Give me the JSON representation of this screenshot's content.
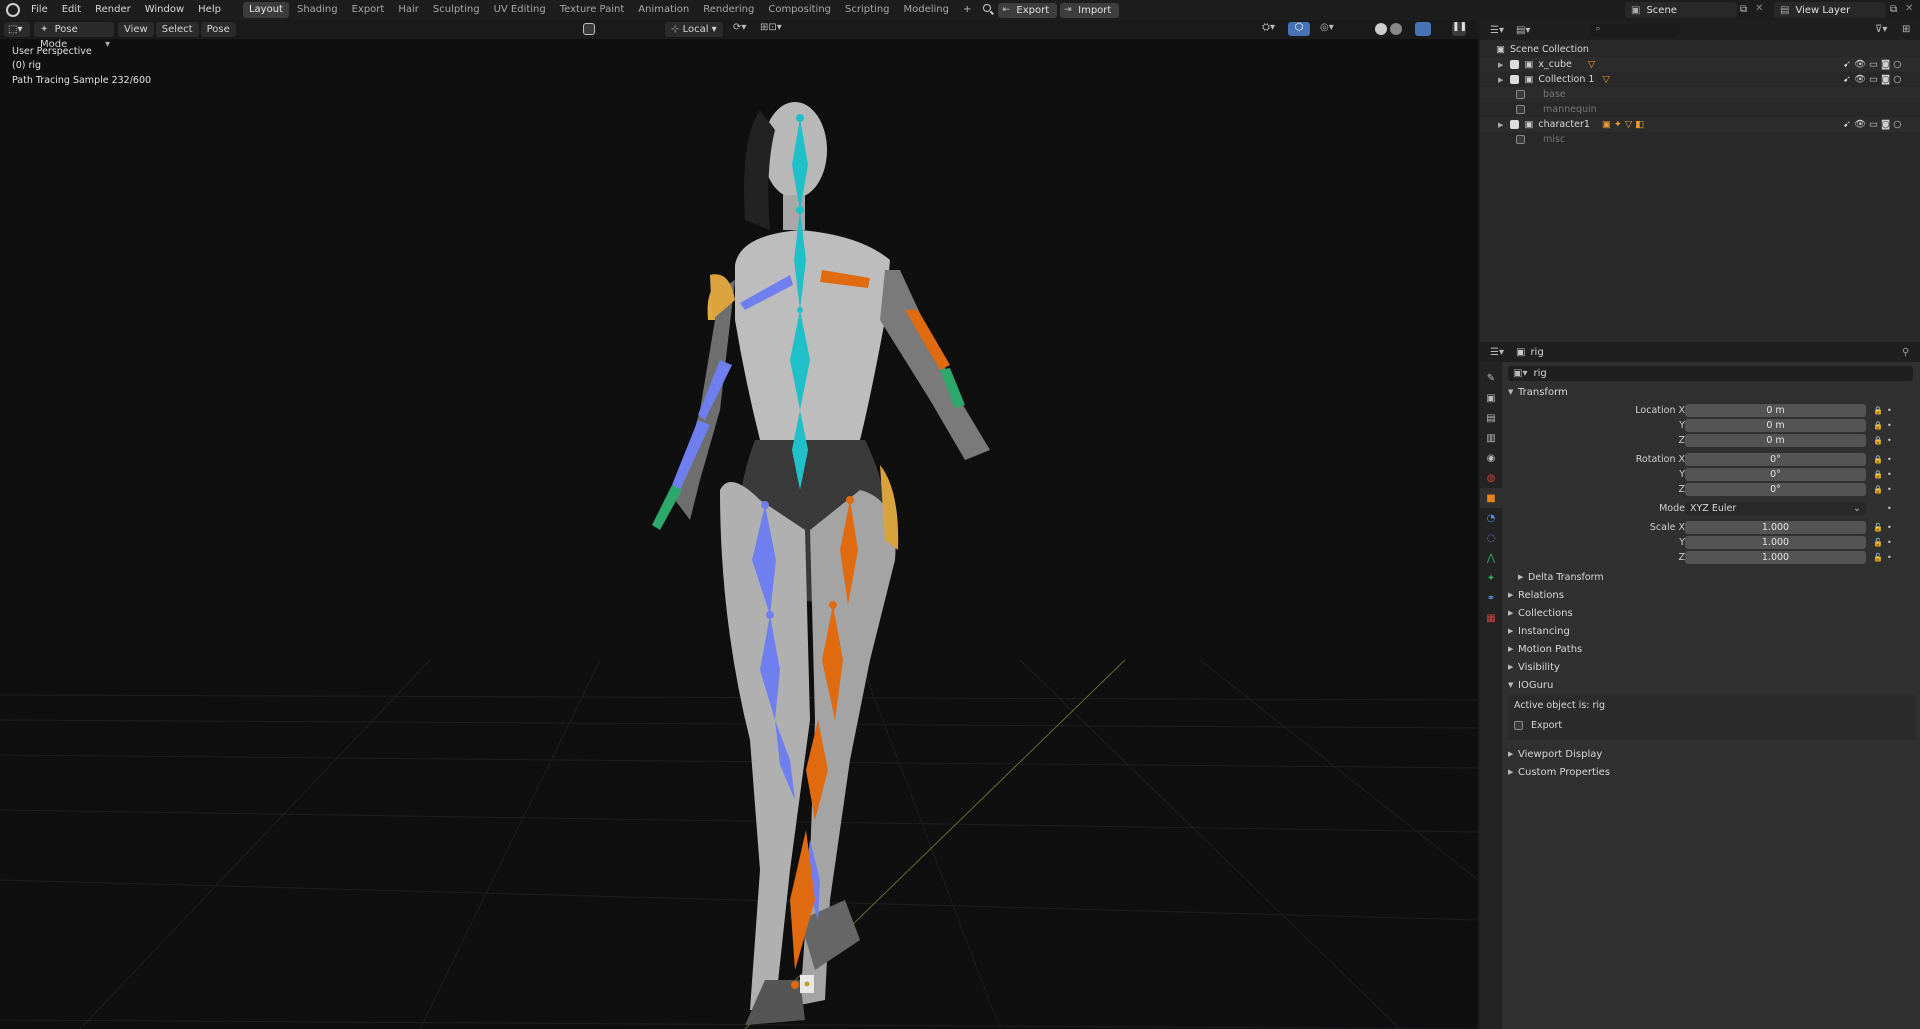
{
  "menu": [
    "File",
    "Edit",
    "Render",
    "Window",
    "Help"
  ],
  "workspaces": [
    "Layout",
    "Shading",
    "Export",
    "Hair",
    "Sculpting",
    "UV Editing",
    "Texture Paint",
    "Animation",
    "Rendering",
    "Compositing",
    "Scripting",
    "Modeling"
  ],
  "active_workspace": "Layout",
  "toolbar_buttons": {
    "export": "Export",
    "import": "Import"
  },
  "scene": "Scene",
  "view_layer": "View Layer",
  "viewport": {
    "mode": "Pose Mode",
    "header_menus": [
      "View",
      "Select",
      "Pose"
    ],
    "orientation": "Local",
    "overlay_lines": [
      "User Perspective",
      "(0) rig",
      "Path Tracing Sample 232/600"
    ]
  },
  "outliner": {
    "root": "Scene Collection",
    "items": [
      {
        "name": "x_cube",
        "checked": true,
        "expand": true,
        "dim": false
      },
      {
        "name": "Collection 1",
        "checked": true,
        "expand": true,
        "dim": false
      },
      {
        "name": "base",
        "checked": false,
        "expand": false,
        "dim": true
      },
      {
        "name": "mannequin",
        "checked": false,
        "expand": false,
        "dim": true
      },
      {
        "name": "character1",
        "checked": true,
        "expand": true,
        "dim": false
      },
      {
        "name": "misc",
        "checked": false,
        "expand": false,
        "dim": true
      }
    ]
  },
  "properties": {
    "object_name": "rig",
    "name_field": "rig",
    "transform_title": "Transform",
    "location": {
      "label_x": "Location X",
      "x": "0 m",
      "y": "0 m",
      "z": "0 m"
    },
    "rotation": {
      "label_x": "Rotation X",
      "x": "0°",
      "y": "0°",
      "z": "0°"
    },
    "mode": {
      "label": "Mode",
      "value": "XYZ Euler"
    },
    "scale": {
      "label_x": "Scale X",
      "x": "1.000",
      "y": "1.000",
      "z": "1.000"
    },
    "axis_y": "Y",
    "axis_z": "Z",
    "sections": [
      "Delta Transform",
      "Relations",
      "Collections",
      "Instancing",
      "Motion Paths",
      "Visibility",
      "IOGuru"
    ],
    "ioguru": {
      "active_text": "Active object is: rig",
      "export_label": "Export"
    },
    "sections_after": [
      "Viewport Display",
      "Custom Properties"
    ]
  },
  "colors": {
    "spine": "#1fc0c8",
    "left_limb": "#6f7ff0",
    "right_limb": "#e06a10",
    "hand": "#2ca86a",
    "accent_orange": "#e89a30"
  }
}
